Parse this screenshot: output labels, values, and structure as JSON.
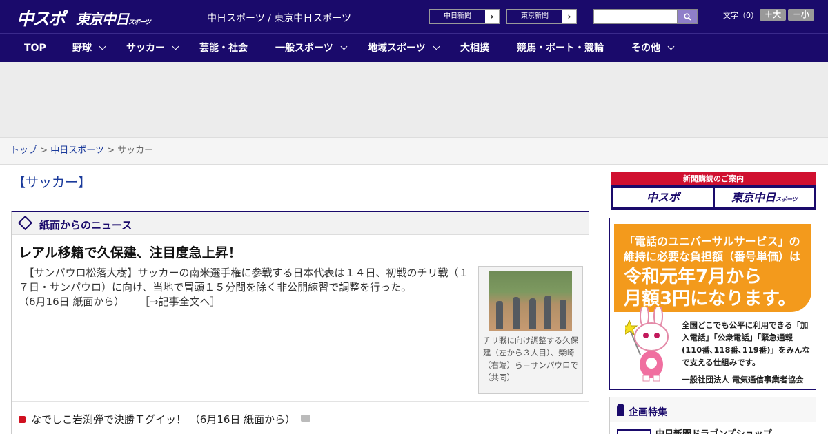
{
  "header": {
    "logo_main": "中スポ",
    "logo_sub": "東京中日",
    "logo_sub_small": "スポーツ",
    "site_title": "中日スポーツ / 東京中日スポーツ",
    "paper_links": [
      "中日新聞",
      "東京新聞"
    ],
    "search": {
      "value": "",
      "placeholder": ""
    },
    "font_size_label": "文字（0）",
    "font_larger": "＋大",
    "font_smaller": "－小"
  },
  "nav": [
    {
      "label": "TOP",
      "has_menu": false
    },
    {
      "label": "野球",
      "has_menu": true
    },
    {
      "label": "サッカー",
      "has_menu": true
    },
    {
      "label": "芸能・社会",
      "has_menu": false
    },
    {
      "label": "一般スポーツ",
      "has_menu": true
    },
    {
      "label": "地域スポーツ",
      "has_menu": true
    },
    {
      "label": "大相撲",
      "has_menu": false
    },
    {
      "label": "競馬・ボート・競輪",
      "has_menu": false
    },
    {
      "label": "その他",
      "has_menu": true
    }
  ],
  "breadcrumb": {
    "items": [
      "トップ",
      "中日スポーツ"
    ],
    "current": "サッカー",
    "separator": ">"
  },
  "section_title": "【サッカー】",
  "news_box": {
    "title": "紙面からのニュース",
    "headline": "レアル移籍で久保建、注目度急上昇！",
    "lead": "　【サンパウロ松落大樹】サッカーの南米選手権に参戦する日本代表は１４日、初戦のチリ戦（１７日・サンパウロ）に向け、当地で冒頭１５分間を除く非公開練習で調整を行った。",
    "lead_date": "（6月16日 紙面から）",
    "more_link": "［→記事全文へ］",
    "photo_caption": "チリ戦に向け調整する久保建（左から３人目）、柴崎（右端）ら＝サンパウロで（共同）",
    "sub_news": "なでしこ岩渕弾で決勝Ｔグイッ！ （6月16日 紙面から）"
  },
  "sidebar": {
    "subscribe_band": "新聞購読のご案内",
    "subscribe_buttons": [
      "中スポ",
      "東京中日"
    ],
    "subscribe_small": "スポーツ",
    "ad": {
      "line1": "「電話のユニバーサルサービス」の",
      "line2": "維持に必要な負担額（番号単価）は",
      "line3": "令和元年7月から",
      "line4": "月額3円になります。",
      "body": "全国どこでも公平に利用できる「加入電話」「公衆電話」「緊急通報(110番､118番､119番)」をみんなで支える仕組みです。",
      "org": "一般社団法人 電気通信事業者協会"
    },
    "feature_title": "企画特集",
    "feature_item": "中日新聞ドラゴンズショップ"
  },
  "colors": {
    "brand_navy": "#1a0a6b",
    "accent_red": "#d01030",
    "ad_orange": "#f39a1c",
    "link_blue": "#1a3a9b"
  }
}
